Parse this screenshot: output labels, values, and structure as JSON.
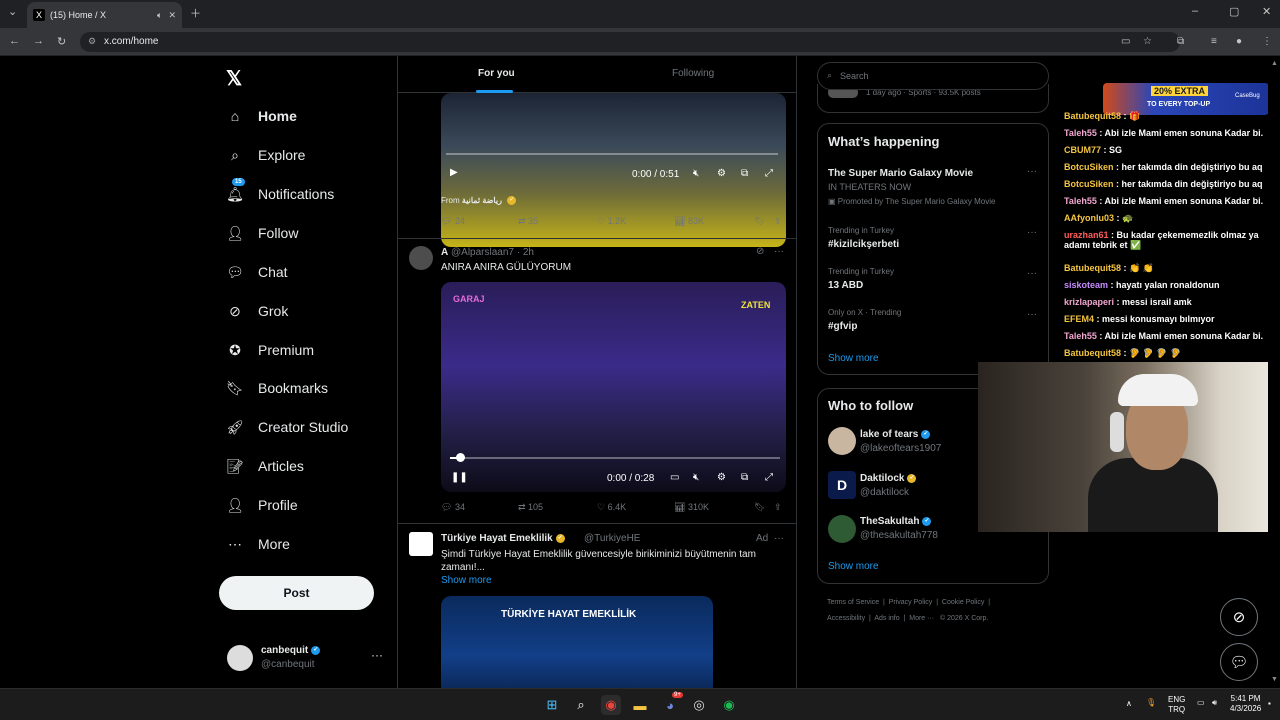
{
  "browser": {
    "tab_title": "(15) Home / X",
    "tab_favicon": "X",
    "url": "x.com/home"
  },
  "sidebar": {
    "logo": "𝕏",
    "items": [
      {
        "label": "Home",
        "icon": "home-icon",
        "glyph": "⌂"
      },
      {
        "label": "Explore",
        "icon": "search-icon",
        "glyph": "⌕"
      },
      {
        "label": "Notifications",
        "icon": "bell-icon",
        "glyph": "🔔︎"
      },
      {
        "label": "Follow",
        "icon": "person-plus-icon",
        "glyph": "👤︎"
      },
      {
        "label": "Chat",
        "icon": "chat-bubble-icon",
        "glyph": "💬︎"
      },
      {
        "label": "Grok",
        "icon": "grok-icon",
        "glyph": "⊘"
      },
      {
        "label": "Premium",
        "icon": "verified-badge-icon",
        "glyph": "✪"
      },
      {
        "label": "Bookmarks",
        "icon": "bookmark-icon",
        "glyph": "🔖︎"
      },
      {
        "label": "Creator Studio",
        "icon": "rocket-icon",
        "glyph": "🚀︎"
      },
      {
        "label": "Articles",
        "icon": "article-icon",
        "glyph": "📝︎"
      },
      {
        "label": "Profile",
        "icon": "person-icon",
        "glyph": "👤︎"
      },
      {
        "label": "More",
        "icon": "more-circle-icon",
        "glyph": "⋯"
      }
    ],
    "notifications_badge": "15",
    "post_label": "Post",
    "user": {
      "name": "canbequit",
      "handle": "@canbequit"
    }
  },
  "feed": {
    "tabs": [
      "For you",
      "Following"
    ],
    "tweet1": {
      "time": "0:00 / 0:51",
      "from_label": "From",
      "from_account": "رياضة ثمانية",
      "replies": "24",
      "reposts": "35",
      "likes": "1.2K",
      "views": "83K"
    },
    "tweet2": {
      "name": "A",
      "handle": "@Alparslaan7 · 2h",
      "text": "ANIRA ANIRA GÜLÜYORUM",
      "video_label_left": "GARAJ",
      "video_label_right": "ZATEN",
      "time": "0:00 / 0:28",
      "progress": 0.03,
      "replies": "34",
      "reposts": "105",
      "likes": "6.4K",
      "views": "310K"
    },
    "tweet3": {
      "name": "Türkiye Hayat Emeklilik",
      "handle": "@TurkiyeHE",
      "ad_label": "Ad",
      "text": "Şimdi Türkiye Hayat Emeklilik güvencesiyle birikiminizi büyütmenin tam zamanı!...",
      "show_more": "Show more",
      "media_title": "TÜRKİYE HAYAT EMEKLİLİK"
    }
  },
  "right": {
    "search_placeholder": "Search",
    "prev_meta": "1 day ago · Sports · 93.5K posts",
    "happening_title": "What’s happening",
    "trends": [
      {
        "meta": "",
        "name": "The Super Mario Galaxy Movie",
        "sub": "IN THEATERS NOW",
        "promo": "Promoted by The Super Mario Galaxy Movie"
      },
      {
        "meta": "Trending in Turkey",
        "name": "#kizilcikşerbeti",
        "sub": "",
        "promo": ""
      },
      {
        "meta": "Trending in Turkey",
        "name": "13 ABD",
        "sub": "",
        "promo": ""
      },
      {
        "meta": "Only on X · Trending",
        "name": "#gfvip",
        "sub": "",
        "promo": ""
      }
    ],
    "show_more": "Show more",
    "wtf_title": "Who to follow",
    "wtf": [
      {
        "name": "lake of tears",
        "handle": "@lakeoftears1907",
        "badge": "blue"
      },
      {
        "name": "Daktilock",
        "handle": "@daktilock",
        "badge": "gold"
      },
      {
        "name": "TheSakultah",
        "handle": "@thesakultah778",
        "badge": "blue"
      }
    ],
    "wtf_show_more": "Show more",
    "footer_line1": [
      "Terms of Service",
      "Privacy Policy",
      "Cookie Policy"
    ],
    "footer_line2": [
      "Accessibility",
      "Ads info",
      "More ···",
      "© 2026 X Corp."
    ]
  },
  "chat": {
    "lines": [
      {
        "user": "Batubequit58",
        "msg": "🎁",
        "color": "#f4c542"
      },
      {
        "user": "Taleh55",
        "msg": "Abi izle Mami emen sonuna Kadar bi.",
        "color": "#f3a6d0"
      },
      {
        "user": "CBUM77",
        "msg": "SG",
        "color": "#f4c542"
      },
      {
        "user": "BotcuSiken",
        "msg": "her takımda din değiştiriyo bu aq",
        "color": "#f4c542"
      },
      {
        "user": "BotcuSiken",
        "msg": "her takımda din değiştiriyo bu aq",
        "color": "#f4c542"
      },
      {
        "user": "Taleh55",
        "msg": "Abi izle Mami emen sonuna Kadar bi.",
        "color": "#f3a6d0"
      },
      {
        "user": "AAfyonlu03",
        "msg": "🐢",
        "color": "#f4c542"
      },
      {
        "user": "urazhan61",
        "msg": "Bu kadar çekememezlik olmaz ya adamı tebrik et ✅",
        "color": "#ff5c5c"
      },
      {
        "user": "Batubequit58",
        "msg": "👏 👏",
        "color": "#f4c542"
      },
      {
        "user": "siskoteam",
        "msg": "hayatı yalan ronaldonun",
        "color": "#c58cff"
      },
      {
        "user": "krizlapaperi",
        "msg": "messi israil amk",
        "color": "#f3a6d0"
      },
      {
        "user": "EFEM4",
        "msg": "messi konusmayı bılmıyor",
        "color": "#f4c542"
      },
      {
        "user": "Taleh55",
        "msg": "Abi izle Mami emen sonuna Kadar bi.",
        "color": "#f3a6d0"
      },
      {
        "user": "Batubequit58",
        "msg": "🦻 🦻 🦻 🦻",
        "color": "#f4c542"
      }
    ],
    "promo_line1": "20% EXTRA",
    "promo_line2": "TO EVERY TOP-UP",
    "promo_brand": "CaseBug"
  },
  "taskbar": {
    "lang1": "ENG",
    "lang2": "TRQ",
    "time": "5:41 PM",
    "date": "4/3/2026",
    "discord_badge": "9+"
  },
  "colors": {
    "accent": "#1d9bf0",
    "background": "#000000",
    "border": "#2f3336",
    "muted": "#71767b"
  }
}
